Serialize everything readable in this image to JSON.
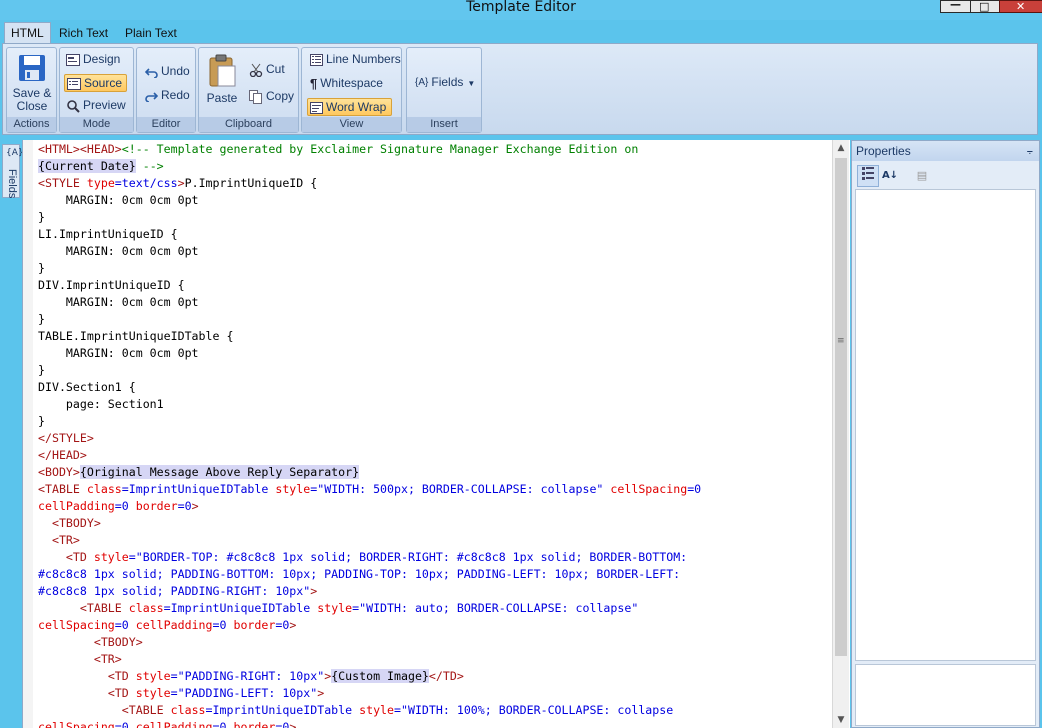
{
  "window": {
    "title": "Template Editor",
    "min_glyph": "—",
    "max_glyph": "□",
    "close_glyph": "✕"
  },
  "tabs": [
    "HTML",
    "Rich Text",
    "Plain Text"
  ],
  "ribbon": {
    "actions": {
      "caption": "Actions",
      "save_close_line1": "Save &",
      "save_close_line2": "Close"
    },
    "mode": {
      "caption": "Mode",
      "design": "Design",
      "source": "Source",
      "preview": "Preview"
    },
    "editor": {
      "caption": "Editor",
      "undo": "Undo",
      "redo": "Redo"
    },
    "clipboard": {
      "caption": "Clipboard",
      "paste": "Paste",
      "cut": "Cut",
      "copy": "Copy"
    },
    "view": {
      "caption": "View",
      "line_numbers": "Line Numbers",
      "whitespace": "Whitespace",
      "word_wrap": "Word Wrap"
    },
    "insert": {
      "caption": "Insert",
      "fields": "Fields"
    }
  },
  "side_tab": {
    "label": "Fields",
    "icon_text": "{A}"
  },
  "properties": {
    "title": "Properties",
    "pin_glyph": "⨪"
  },
  "code_lines": [
    [
      [
        "t",
        "<HTML>"
      ],
      [
        "t",
        "<HEAD>"
      ],
      [
        "c",
        "<!-- Template generated by Exclaimer Signature Manager Exchange Edition on"
      ]
    ],
    [
      [
        "f",
        "{Current Date}"
      ],
      [
        "c",
        " -->"
      ]
    ],
    [
      [
        "t",
        "<STYLE "
      ],
      [
        "a",
        "type"
      ],
      [
        "v",
        "=text/css"
      ],
      [
        "t",
        ">"
      ],
      [
        "p",
        "P.ImprintUniqueID {"
      ]
    ],
    [
      [
        "p",
        "    MARGIN: 0cm 0cm 0pt"
      ]
    ],
    [
      [
        "p",
        "}"
      ]
    ],
    [
      [
        "p",
        "LI.ImprintUniqueID {"
      ]
    ],
    [
      [
        "p",
        "    MARGIN: 0cm 0cm 0pt"
      ]
    ],
    [
      [
        "p",
        "}"
      ]
    ],
    [
      [
        "p",
        "DIV.ImprintUniqueID {"
      ]
    ],
    [
      [
        "p",
        "    MARGIN: 0cm 0cm 0pt"
      ]
    ],
    [
      [
        "p",
        "}"
      ]
    ],
    [
      [
        "p",
        "TABLE.ImprintUniqueIDTable {"
      ]
    ],
    [
      [
        "p",
        "    MARGIN: 0cm 0cm 0pt"
      ]
    ],
    [
      [
        "p",
        "}"
      ]
    ],
    [
      [
        "p",
        "DIV.Section1 {"
      ]
    ],
    [
      [
        "p",
        "    page: Section1"
      ]
    ],
    [
      [
        "p",
        "}"
      ]
    ],
    [
      [
        "t",
        "</STYLE>"
      ]
    ],
    [
      [
        "t",
        "</HEAD>"
      ]
    ],
    [
      [
        "t",
        "<BODY>"
      ],
      [
        "f",
        "{Original Message Above Reply Separator}"
      ]
    ],
    [
      [
        "t",
        "<TABLE "
      ],
      [
        "a",
        "class"
      ],
      [
        "v",
        "=ImprintUniqueIDTable "
      ],
      [
        "a",
        "style"
      ],
      [
        "v",
        "=\"WIDTH: 500px; BORDER-COLLAPSE: collapse\" "
      ],
      [
        "a",
        "cellSpacing"
      ],
      [
        "v",
        "=0"
      ]
    ],
    [
      [
        "a",
        "cellPadding"
      ],
      [
        "v",
        "=0 "
      ],
      [
        "a",
        "border"
      ],
      [
        "v",
        "=0"
      ],
      [
        "t",
        ">"
      ]
    ],
    [
      [
        "p",
        "  "
      ],
      [
        "t",
        "<TBODY>"
      ]
    ],
    [
      [
        "p",
        "  "
      ],
      [
        "t",
        "<TR>"
      ]
    ],
    [
      [
        "p",
        "    "
      ],
      [
        "t",
        "<TD "
      ],
      [
        "a",
        "style"
      ],
      [
        "v",
        "=\"BORDER-TOP: #c8c8c8 1px solid; BORDER-RIGHT: #c8c8c8 1px solid; BORDER-BOTTOM:"
      ]
    ],
    [
      [
        "v",
        "#c8c8c8 1px solid; PADDING-BOTTOM: 10px; PADDING-TOP: 10px; PADDING-LEFT: 10px; BORDER-LEFT:"
      ]
    ],
    [
      [
        "v",
        "#c8c8c8 1px solid; PADDING-RIGHT: 10px\""
      ],
      [
        "t",
        ">"
      ]
    ],
    [
      [
        "p",
        "      "
      ],
      [
        "t",
        "<TABLE "
      ],
      [
        "a",
        "class"
      ],
      [
        "v",
        "=ImprintUniqueIDTable "
      ],
      [
        "a",
        "style"
      ],
      [
        "v",
        "=\"WIDTH: auto; BORDER-COLLAPSE: collapse\""
      ]
    ],
    [
      [
        "a",
        "cellSpacing"
      ],
      [
        "v",
        "=0 "
      ],
      [
        "a",
        "cellPadding"
      ],
      [
        "v",
        "=0 "
      ],
      [
        "a",
        "border"
      ],
      [
        "v",
        "=0"
      ],
      [
        "t",
        ">"
      ]
    ],
    [
      [
        "p",
        "        "
      ],
      [
        "t",
        "<TBODY>"
      ]
    ],
    [
      [
        "p",
        "        "
      ],
      [
        "t",
        "<TR>"
      ]
    ],
    [
      [
        "p",
        "          "
      ],
      [
        "t",
        "<TD "
      ],
      [
        "a",
        "style"
      ],
      [
        "v",
        "=\"PADDING-RIGHT: 10px\""
      ],
      [
        "t",
        ">"
      ],
      [
        "f",
        "{Custom Image}"
      ],
      [
        "t",
        "</TD>"
      ]
    ],
    [
      [
        "p",
        "          "
      ],
      [
        "t",
        "<TD "
      ],
      [
        "a",
        "style"
      ],
      [
        "v",
        "=\"PADDING-LEFT: 10px\""
      ],
      [
        "t",
        ">"
      ]
    ],
    [
      [
        "p",
        "            "
      ],
      [
        "t",
        "<TABLE "
      ],
      [
        "a",
        "class"
      ],
      [
        "v",
        "=ImprintUniqueIDTable "
      ],
      [
        "a",
        "style"
      ],
      [
        "v",
        "=\"WIDTH: 100%; BORDER-COLLAPSE: collapse"
      ]
    ],
    [
      [
        "a",
        "cellSpacing"
      ],
      [
        "v",
        "=0 "
      ],
      [
        "a",
        "cellPadding"
      ],
      [
        "v",
        "=0 "
      ],
      [
        "a",
        "border"
      ],
      [
        "v",
        "=0"
      ],
      [
        "t",
        ">"
      ]
    ]
  ]
}
